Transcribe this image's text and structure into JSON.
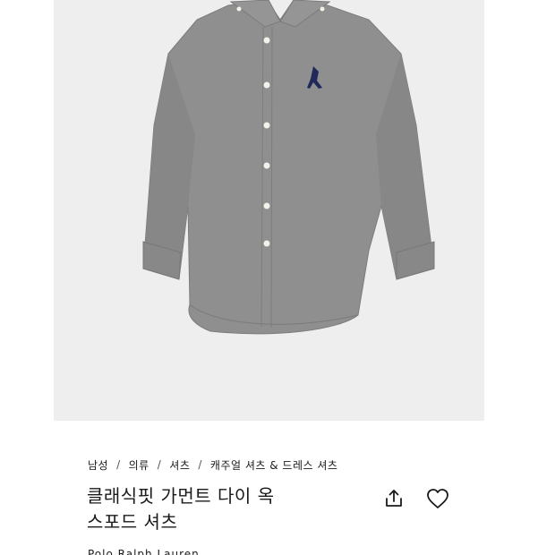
{
  "breadcrumb": {
    "items": [
      "남성",
      "의류",
      "셔츠",
      "캐주얼 셔츠 & 드레스 셔츠"
    ],
    "separator": "/"
  },
  "product": {
    "title_line1": "클래식핏 가먼트 다이 옥",
    "title_line2": "스포드 셔츠",
    "brand": "Polo Ralph Lauren"
  },
  "icons": {
    "share": "share-icon",
    "wishlist": "heart-icon"
  },
  "colors": {
    "image_background": "#eeeeee",
    "shirt": "#8e8f8e",
    "logo": "#1f2a5a",
    "text": "#1a1a1a"
  }
}
